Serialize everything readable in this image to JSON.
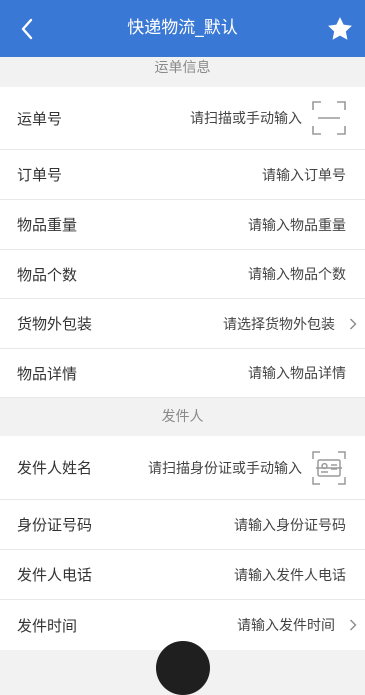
{
  "header": {
    "title": "快递物流_默认",
    "back_icon": "chevron-left-icon",
    "star_icon": "star-icon",
    "bg_color": "#3a78d6"
  },
  "sections": {
    "waybill": {
      "title": "运单信息",
      "rows": {
        "waybill_no": {
          "label": "运单号",
          "placeholder": "请扫描或手动输入"
        },
        "order_no": {
          "label": "订单号",
          "placeholder": "请输入订单号"
        },
        "weight": {
          "label": "物品重量",
          "placeholder": "请输入物品重量"
        },
        "count": {
          "label": "物品个数",
          "placeholder": "请输入物品个数"
        },
        "package": {
          "label": "货物外包装",
          "placeholder": "请选择货物外包装"
        },
        "details": {
          "label": "物品详情",
          "placeholder": "请输入物品详情"
        }
      }
    },
    "sender": {
      "title": "发件人",
      "rows": {
        "name": {
          "label": "发件人姓名",
          "placeholder": "请扫描身份证或手动输入"
        },
        "id_no": {
          "label": "身份证号码",
          "placeholder": "请输入身份证号码"
        },
        "phone": {
          "label": "发件人电话",
          "placeholder": "请输入发件人电话"
        },
        "time": {
          "label": "发件时间",
          "placeholder": "请输入发件时间"
        }
      }
    }
  }
}
